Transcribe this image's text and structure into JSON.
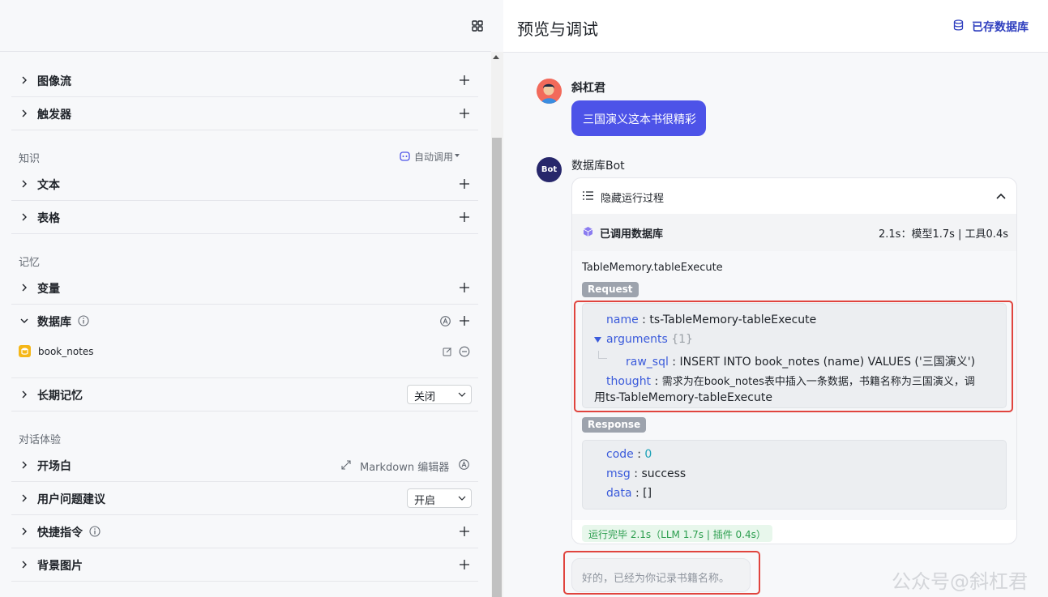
{
  "left": {
    "sections": {
      "knowledge": "知识",
      "memory": "记忆",
      "dialog": "对话体验"
    },
    "rows": {
      "image_flow": "图像流",
      "trigger": "触发器",
      "text": "文本",
      "table": "表格",
      "variable": "变量",
      "database": "数据库",
      "long_memory": "长期记忆",
      "opening": "开场白",
      "suggestions": "用户问题建议",
      "shortcuts": "快捷指令",
      "background": "背景图片"
    },
    "auto_invoke": "自动调用",
    "db_item": "book_notes",
    "long_memory_value": "关闭",
    "suggestions_value": "开启",
    "markdown_editor": "Markdown 编辑器"
  },
  "right": {
    "title": "预览与调试",
    "saved_db": "已存数据库",
    "user_name": "斜杠君",
    "user_message": "三国演义这本书很精彩",
    "bot_name": "数据库Bot",
    "bot_avatar_label": "Bot",
    "hide_process": "隐藏运行过程",
    "called_db": "已调用数据库",
    "timing": "2.1s：模型1.7s | 工具0.4s",
    "function": "TableMemory.tableExecute",
    "request_tag": "Request",
    "response_tag": "Response",
    "request": {
      "name_key": "name",
      "name_value": "ts-TableMemory-tableExecute",
      "arguments_key": "arguments",
      "arguments_count": "{1}",
      "raw_sql_key": "raw_sql",
      "raw_sql_value": "INSERT INTO book_notes (name) VALUES ('三国演义')",
      "thought_key": "thought",
      "thought_value_line1": "需求为在book_notes表中插入一条数据，书籍名称为三国演义，调",
      "thought_value_line2": "用ts-TableMemory-tableExecute"
    },
    "response": {
      "code_key": "code",
      "code_value": "0",
      "msg_key": "msg",
      "msg_value": "success",
      "data_key": "data",
      "data_value": "[]"
    },
    "done": "运行完毕 2.1s（LLM 1.7s | 插件 0.4s）",
    "reply": "好的，已经为你记录书籍名称。",
    "watermark": "公众号@斜杠君"
  },
  "colors": {
    "accent": "#4d53e8",
    "highlight": "#e0443e",
    "link": "#2f3fbf",
    "success": "#2a9d4d"
  }
}
